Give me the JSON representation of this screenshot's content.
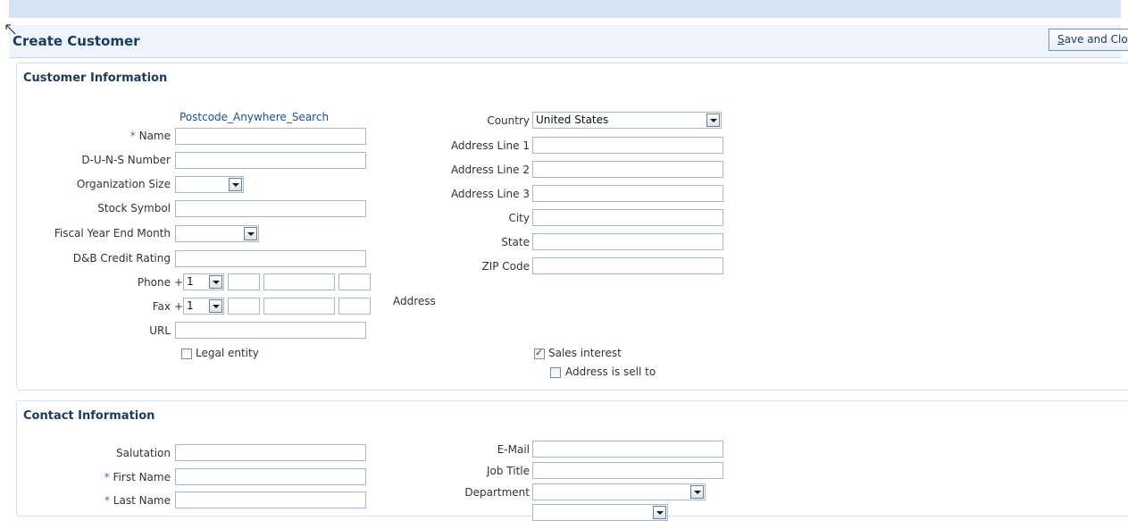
{
  "header": {
    "title": "Create Customer",
    "save_close_label_u": "S",
    "save_close_label_rest": "ave and Close"
  },
  "customer": {
    "section_title": "Customer Information",
    "postcode_link": "Postcode_Anywhere_Search",
    "required_marker": "*",
    "name_label": "Name",
    "duns_label": "D-U-N-S Number",
    "org_size_label": "Organization Size",
    "stock_symbol_label": "Stock Symbol",
    "fiscal_label": "Fiscal Year End Month",
    "credit_label": "D&B Credit Rating",
    "phone_label": "Phone",
    "fax_label": "Fax",
    "plus": "+",
    "phone_country_code": "1",
    "fax_country_code": "1",
    "url_label": "URL",
    "legal_entity_label": "Legal entity",
    "address_label": "Address",
    "country_label": "Country",
    "country_value": "United States",
    "address1_label": "Address Line 1",
    "address2_label": "Address Line 2",
    "address3_label": "Address Line 3",
    "city_label": "City",
    "state_label": "State",
    "zip_label": "ZIP Code",
    "sales_interest_label": "Sales interest",
    "sell_to_label": "Address is sell to"
  },
  "contact": {
    "section_title": "Contact Information",
    "salutation_label": "Salutation",
    "first_name_label": "First Name",
    "last_name_label": "Last Name",
    "email_label": "E-Mail",
    "job_title_label": "Job Title",
    "department_label": "Department"
  }
}
